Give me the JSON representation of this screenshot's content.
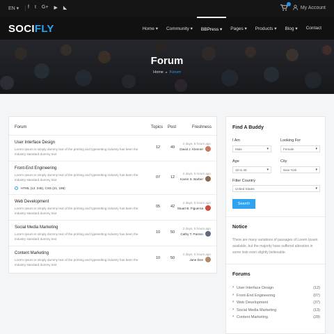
{
  "topbar": {
    "language": "EN",
    "socials": [
      {
        "icon": "facebook-icon",
        "glyph": "f"
      },
      {
        "icon": "twitter-icon",
        "glyph": "t"
      },
      {
        "icon": "google-plus-icon",
        "glyph": "G+"
      },
      {
        "icon": "youtube-icon",
        "glyph": "▶"
      },
      {
        "icon": "rss-icon",
        "glyph": "◣"
      }
    ],
    "account_label": "My Account"
  },
  "brand": {
    "part1": "SOCI",
    "part2": "FLY",
    "accent": "#2ea3f2"
  },
  "nav": [
    {
      "label": "Home ▾"
    },
    {
      "label": "Community ▾"
    },
    {
      "label": "BBPress ▾"
    },
    {
      "label": "Pages ▾"
    },
    {
      "label": "Products ▾"
    },
    {
      "label": "Blog ▾"
    },
    {
      "label": "Contact"
    }
  ],
  "hero": {
    "title": "Forum",
    "breadcrumb_home": "Home",
    "breadcrumb_sep": "▸",
    "breadcrumb_current": "Forum"
  },
  "forum_table": {
    "headers": {
      "forum": "Forum",
      "topics": "Topics",
      "post": "Post",
      "freshness": "Freshness"
    },
    "rows": [
      {
        "title": "User Interface Design",
        "desc": "Lorem Ipsum is simply dummy text of the printing and typesetting industry has been the industry standard dummy text",
        "topics": "12",
        "posts": "49",
        "time": "2 days, 5 hours ago",
        "user": "David J. Klenner"
      },
      {
        "title": "Front-End Engineering",
        "desc": "Lorem Ipsum is simply dummy text of the printing and typesetting industry has been the industry standard dummy text",
        "topics": "07",
        "posts": "12",
        "time": "2 days, 5 hours ago",
        "user": "Karen S. Barber",
        "sub": "HTML (12, 245), CSS (21, 198)"
      },
      {
        "title": "Web Development",
        "desc": "Lorem Ipsum is simply dummy text of the printing and typesetting industry has been the industry standard dummy text",
        "topics": "05",
        "posts": "42",
        "time": "2 days, 5 hours ago",
        "user": "Stuart B. Figueroa"
      },
      {
        "title": "Social Media Marketing",
        "desc": "Lorem Ipsum is simply dummy text of the printing and typesetting industry has been the industry standard dummy text",
        "topics": "10",
        "posts": "50",
        "time": "2 days, 5 hours ago",
        "user": "Cathy T. Parson"
      },
      {
        "title": "Content Marketing",
        "desc": "Lorem Ipsum is simply dummy text of the printing and typesetting industry has been the industry standard dummy text",
        "topics": "10",
        "posts": "50",
        "time": "2 days, 5 hours ago",
        "user": "Jane Doe"
      }
    ]
  },
  "buddy": {
    "title": "Find A Buddy",
    "i_am_label": "I Am",
    "i_am_value": "Male",
    "looking_for_label": "Looking For",
    "looking_for_value": "Female",
    "age_label": "Age",
    "age_value": "18 to 25",
    "city_label": "City",
    "city_value": "New York",
    "country_label": "Filter Country",
    "country_value": "United States",
    "search_label": "Search"
  },
  "notice": {
    "title": "Notice",
    "text": "There are many variations of passages of Lorem Ipsum available, but the majority have suffered alteration in some look even slightly believable."
  },
  "forums_widget": {
    "title": "Forums",
    "items": [
      {
        "label": "User Interface Design",
        "count": "(12)"
      },
      {
        "label": "Front-End Engineering",
        "count": "(07)"
      },
      {
        "label": "Web Development",
        "count": "(37)"
      },
      {
        "label": "Social Media Marketing",
        "count": "(13)"
      },
      {
        "label": "Content Marketing",
        "count": "(28)"
      }
    ]
  }
}
